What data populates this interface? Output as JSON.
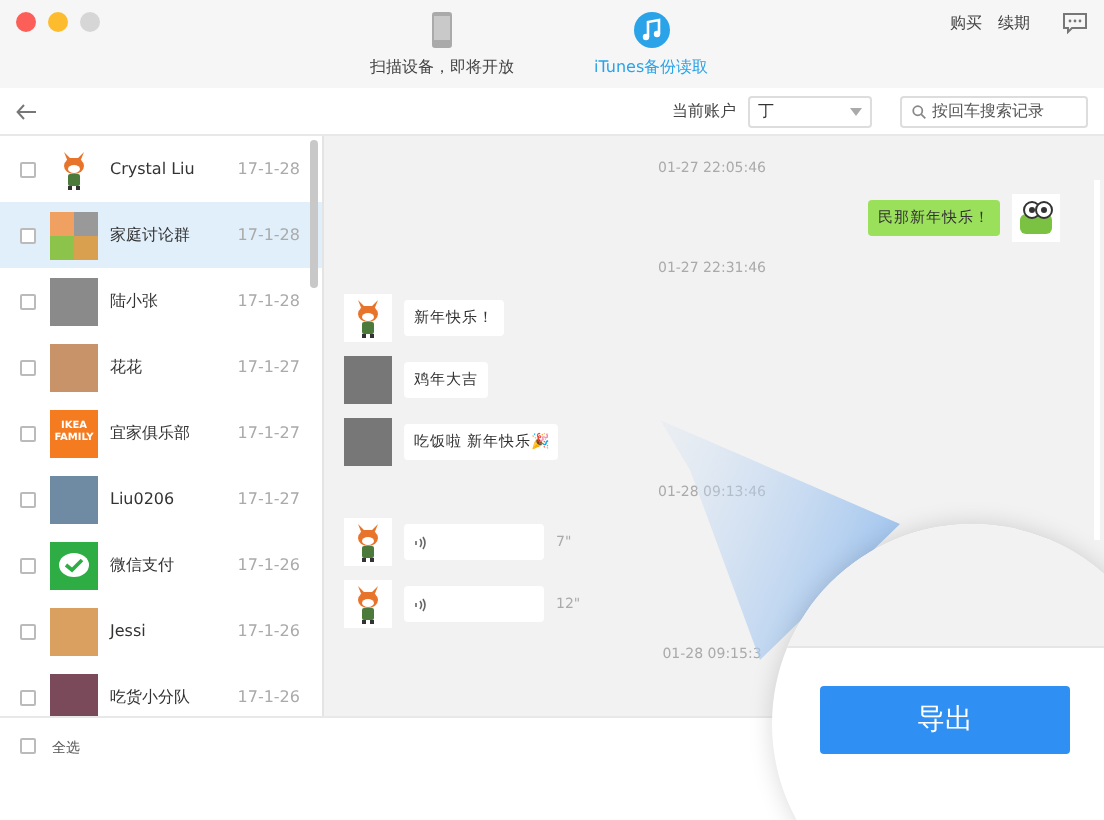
{
  "window": {
    "controls": [
      {
        "kind": "close"
      },
      {
        "kind": "minimize"
      },
      {
        "kind": "zoom"
      }
    ]
  },
  "tabs": [
    {
      "label": "扫描设备，即将开放",
      "kind": "phone",
      "selected": false
    },
    {
      "label": "iTunes备份读取",
      "kind": "music",
      "selected": true
    }
  ],
  "header_links": [
    "购买",
    "续期"
  ],
  "toolbar": {
    "account_label": "当前账户",
    "account_value": "丁",
    "search": {
      "placeholder": "按回车搜索记录"
    }
  },
  "contacts": [
    {
      "name": "Crystal Liu",
      "date": "17-1-28",
      "checked": false,
      "selected": false,
      "avatar": {
        "kind": "fox"
      }
    },
    {
      "name": "家庭讨论群",
      "date": "17-1-28",
      "checked": false,
      "selected": true,
      "avatar": {
        "kind": "group"
      }
    },
    {
      "name": "陆小张",
      "date": "17-1-28",
      "checked": false,
      "selected": false,
      "avatar": {
        "kind": "photo",
        "color": "#8a8a8a"
      }
    },
    {
      "name": "花花",
      "date": "17-1-27",
      "checked": false,
      "selected": false,
      "avatar": {
        "kind": "photo",
        "color": "#c9936a"
      }
    },
    {
      "name": "宜家俱乐部",
      "date": "17-1-27",
      "checked": false,
      "selected": false,
      "avatar": {
        "kind": "logo",
        "lines": [
          "IKEA",
          "FAMILY"
        ]
      }
    },
    {
      "name": "Liu0206",
      "date": "17-1-27",
      "checked": false,
      "selected": false,
      "avatar": {
        "kind": "photo",
        "color": "#6f8aa3"
      }
    },
    {
      "name": "微信支付",
      "date": "17-1-26",
      "checked": false,
      "selected": false,
      "avatar": {
        "kind": "pay"
      }
    },
    {
      "name": "Jessi",
      "date": "17-1-26",
      "checked": false,
      "selected": false,
      "avatar": {
        "kind": "photo",
        "color": "#d9a060"
      }
    },
    {
      "name": "吃货小分队",
      "date": "17-1-26",
      "checked": false,
      "selected": false,
      "avatar": {
        "kind": "photo",
        "color": "#7a4a5a"
      }
    }
  ],
  "messages": [
    {
      "kind": "time",
      "text": "01-27 22:05:46"
    },
    {
      "kind": "outgoing",
      "text": "民那新年快乐！",
      "avatar": {
        "kind": "frog"
      }
    },
    {
      "kind": "time",
      "text": "01-27 22:31:46"
    },
    {
      "kind": "incoming",
      "text": "新年快乐！",
      "avatar": {
        "kind": "fox"
      }
    },
    {
      "kind": "incoming",
      "text": "鸡年大吉",
      "avatar": {
        "kind": "photo"
      }
    },
    {
      "kind": "incoming",
      "text": "吃饭啦 新年快乐🎉",
      "avatar": {
        "kind": "photo"
      }
    },
    {
      "kind": "time",
      "text": "01-28 09:13:46"
    },
    {
      "kind": "voice",
      "duration": "7\"",
      "avatar": {
        "kind": "fox"
      }
    },
    {
      "kind": "voice",
      "duration": "12\"",
      "avatar": {
        "kind": "fox"
      }
    },
    {
      "kind": "time",
      "text": "01-28 09:15:3"
    }
  ],
  "footer": {
    "select_all": {
      "label": "全选",
      "checked": false
    }
  },
  "export_button": "导出"
}
